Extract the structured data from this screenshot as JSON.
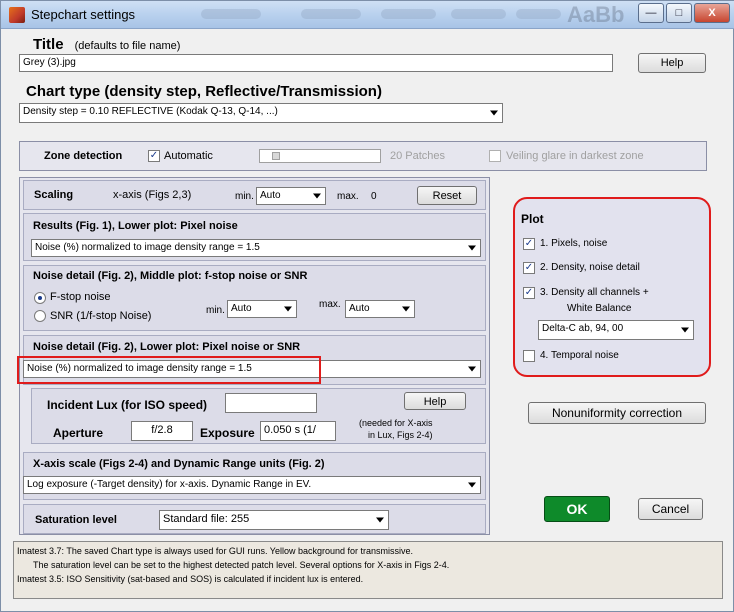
{
  "window": {
    "title": "Stepchart settings",
    "ghost_text": "AaBb",
    "buttons": {
      "minimize": "—",
      "maximize": "□",
      "close": "X"
    }
  },
  "title_section": {
    "heading": "Title",
    "hint": "(defaults to file name)",
    "value": "Grey (3).jpg",
    "help": "Help"
  },
  "chart_type": {
    "heading": "Chart type (density step, Reflective/Transmission)",
    "selected": "Density step = 0.10  REFLECTIVE        (Kodak Q-13, Q-14, ...)"
  },
  "zone_detection": {
    "label": "Zone detection",
    "automatic": "Automatic",
    "automatic_checked": true,
    "patches": "20 Patches",
    "veiling": "Veiling glare in darkest zone",
    "veiling_checked": false
  },
  "scaling": {
    "label": "Scaling",
    "axis": "x-axis (Figs 2,3)",
    "min_label": "min.",
    "min_value": "Auto",
    "max_label": "max.",
    "max_value": "0",
    "reset": "Reset"
  },
  "results": {
    "heading": "Results (Fig. 1), Lower plot:   Pixel noise",
    "selected": "Noise (%) normalized to image density range = 1.5"
  },
  "noise_middle": {
    "heading": "Noise detail (Fig. 2), Middle plot:   f-stop noise or SNR",
    "options": [
      "F-stop noise",
      "SNR (1/f-stop Noise)"
    ],
    "selected_index": 0,
    "min_label": "min.",
    "min_value": "Auto",
    "max_label": "max.",
    "max_value": "Auto"
  },
  "noise_lower": {
    "heading": "Noise detail (Fig. 2), Lower plot:   Pixel noise or SNR",
    "selected": "Noise (%) normalized to image density range = 1.5"
  },
  "lux": {
    "incident_label": "Incident Lux (for ISO speed)",
    "incident_value": "",
    "help": "Help",
    "aperture_label": "Aperture",
    "aperture_value": "f/2.8",
    "exposure_label": "Exposure",
    "exposure_value": "0.050 s  (1/",
    "note_line1": "(needed for X-axis",
    "note_line2": "in Lux, Figs 2-4)"
  },
  "xaxis_scale": {
    "heading": "X-axis scale (Figs 2-4) and Dynamic Range units (Fig. 2)",
    "selected": "Log exposure (-Target density) for x-axis.    Dynamic Range in EV."
  },
  "saturation": {
    "label": "Saturation level",
    "selected": "Standard file:  255"
  },
  "plot": {
    "heading": "Plot",
    "items": [
      {
        "label": "1. Pixels, noise",
        "checked": true
      },
      {
        "label": "2. Density, noise detail",
        "checked": true
      },
      {
        "label": "3. Density all channels +",
        "label2": "White Balance",
        "checked": true
      },
      {
        "label": "4. Temporal noise",
        "checked": false
      }
    ],
    "wb_selected": "Delta-C ab, 94, 00"
  },
  "nonuniformity": "Nonuniformity correction",
  "ok": "OK",
  "cancel": "Cancel",
  "notes": {
    "line1": "Imatest 3.7:  The saved Chart type is always used for GUI runs. Yellow background for transmissive.",
    "line2": "The saturation level can be set to the  highest detected patch level.  Several options for X-axis in Figs 2-4.",
    "line3": "Imatest 3.5:  ISO Sensitivity (sat-based and SOS) is calculated if incident lux is entered."
  },
  "colors": {
    "highlight": "#e01b1b",
    "ok_bg": "#0e8a2a",
    "panel_bg": "#e6e6ee"
  }
}
